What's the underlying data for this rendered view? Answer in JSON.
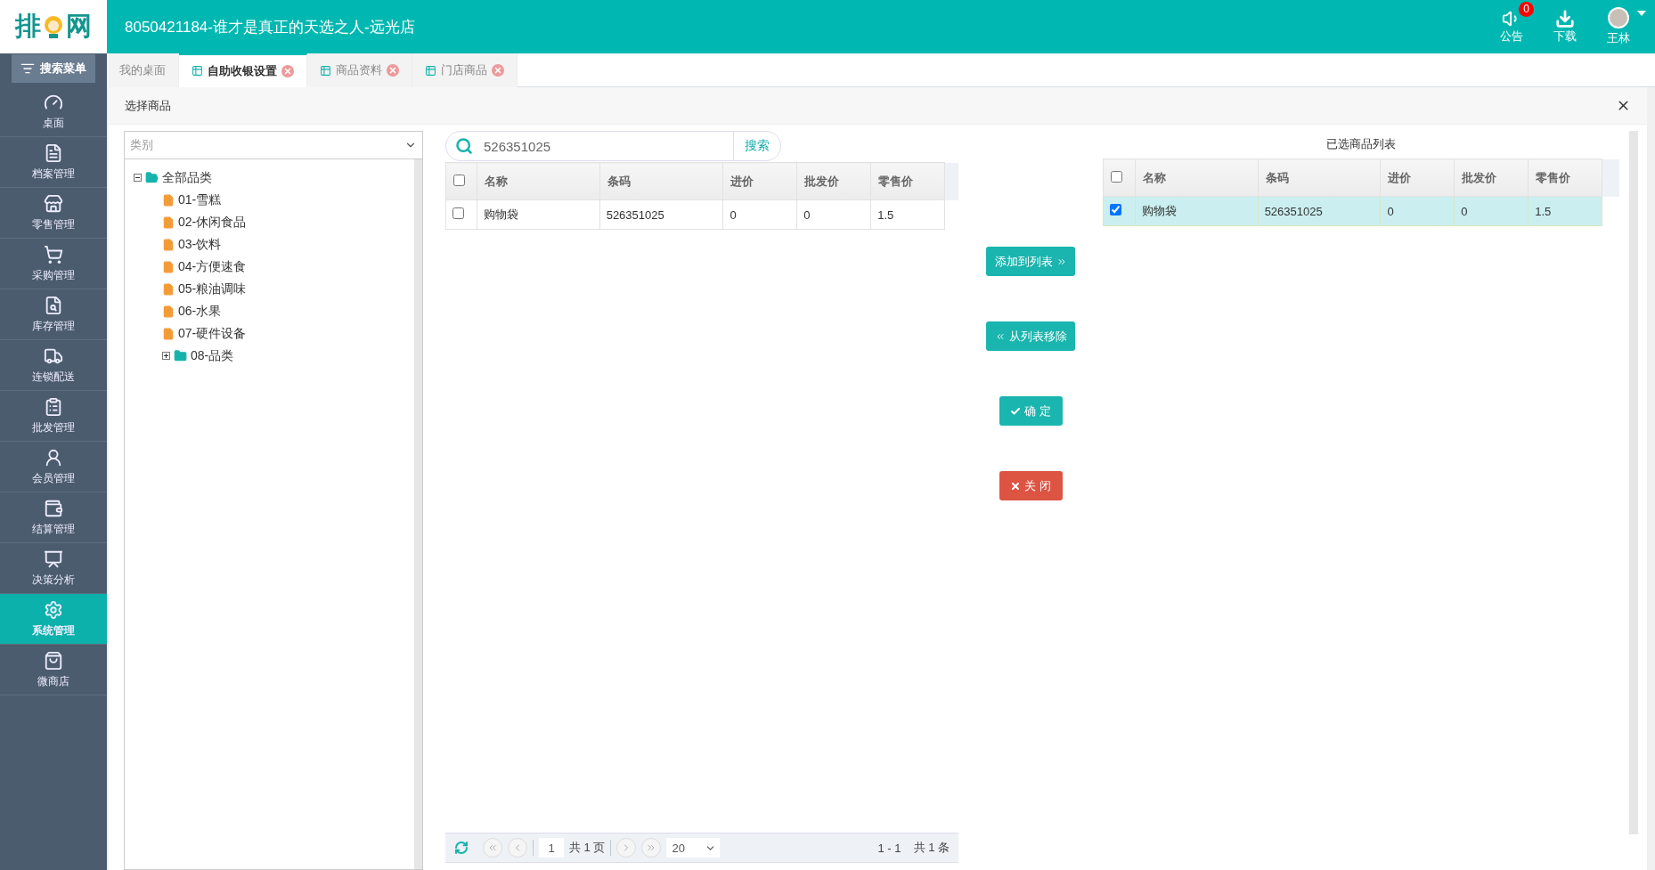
{
  "header": {
    "logo": [
      "排",
      "网"
    ],
    "title": "8050421184-谁才是真正的天选之人-远光店",
    "actions": [
      {
        "label": "公告",
        "badge": "0"
      },
      {
        "label": "下载"
      }
    ],
    "user": {
      "name": "王林"
    }
  },
  "sidebar": {
    "search_button": "搜索菜单",
    "items": [
      {
        "label": "桌面",
        "selected": false
      },
      {
        "label": "档案管理",
        "selected": false
      },
      {
        "label": "零售管理",
        "selected": false
      },
      {
        "label": "采购管理",
        "selected": false
      },
      {
        "label": "库存管理",
        "selected": false
      },
      {
        "label": "连锁配送",
        "selected": false
      },
      {
        "label": "批发管理",
        "selected": false
      },
      {
        "label": "会员管理",
        "selected": false
      },
      {
        "label": "结算管理",
        "selected": false
      },
      {
        "label": "决策分析",
        "selected": false
      },
      {
        "label": "系统管理",
        "selected": true
      },
      {
        "label": "微商店",
        "selected": false
      }
    ]
  },
  "tabs": [
    {
      "label": "我的桌面",
      "selected": false,
      "closable": false
    },
    {
      "label": "自助收银设置",
      "selected": true,
      "closable": true
    },
    {
      "label": "商品资料",
      "selected": false,
      "closable": true
    },
    {
      "label": "门店商品",
      "selected": false,
      "closable": true
    }
  ],
  "dialog": {
    "title": "选择商品",
    "category_select": {
      "placeholder": "类别"
    },
    "tree": [
      {
        "label": "全部品类",
        "expanded": true,
        "children": [
          {
            "label": "01-雪糕"
          },
          {
            "label": "02-休闲食品"
          },
          {
            "label": "03-饮料"
          },
          {
            "label": "04-方便速食"
          },
          {
            "label": "05-粮油调味"
          },
          {
            "label": "06-水果"
          },
          {
            "label": "07-硬件设备"
          },
          {
            "label": "08-品类",
            "expanded": false
          }
        ]
      }
    ],
    "search": {
      "value": "526351025",
      "button": "搜索"
    },
    "product_table": {
      "all_checked": false,
      "columns": [
        "名称",
        "条码",
        "进价",
        "批发价",
        "零售价"
      ],
      "rows": [
        {
          "checked": false,
          "cells": [
            "购物袋",
            "526351025",
            "0",
            "0",
            "1.5"
          ]
        }
      ]
    },
    "pagination": {
      "page": "1",
      "total_pages": "共 1 页",
      "page_size": "20",
      "range": "1 - 1",
      "total": "共 1 条"
    },
    "buttons": [
      {
        "kind": "add",
        "label": "添加到列表"
      },
      {
        "kind": "remove",
        "label": "从列表移除"
      },
      {
        "kind": "confirm",
        "label": "确 定"
      },
      {
        "kind": "close",
        "label": "关 闭"
      }
    ],
    "selected_table": {
      "title": "已选商品列表",
      "all_checked": false,
      "columns": [
        "名称",
        "条码",
        "进价",
        "批发价",
        "零售价"
      ],
      "rows": [
        {
          "checked": true,
          "cells": [
            "购物袋",
            "526351025",
            "0",
            "0",
            "1.5"
          ]
        }
      ]
    }
  }
}
